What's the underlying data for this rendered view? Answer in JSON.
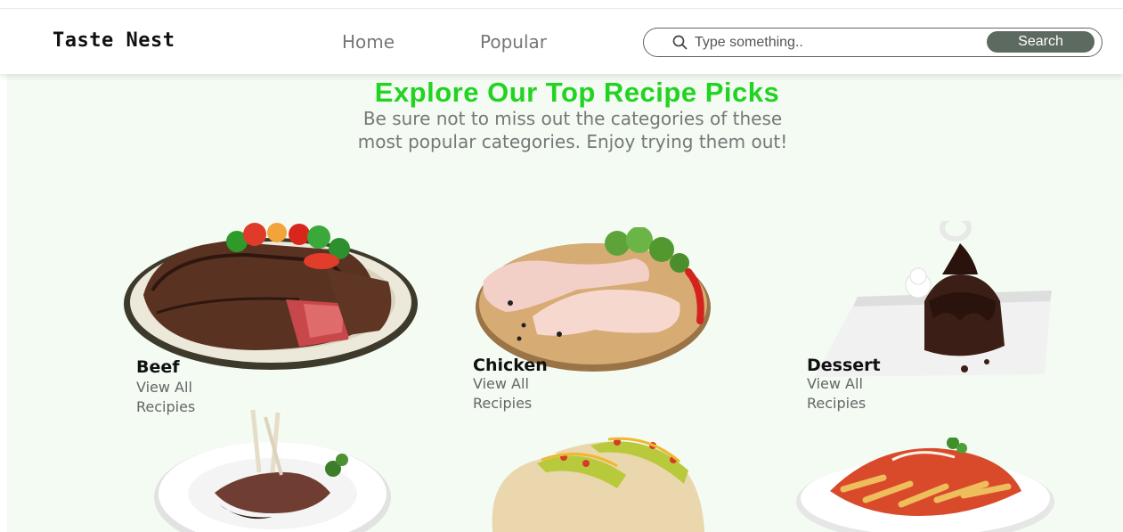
{
  "brand": "Taste Nest",
  "nav": {
    "home": "Home",
    "popular": "Popular"
  },
  "search": {
    "placeholder": "Type something..",
    "button_label": "Search"
  },
  "hero": {
    "title": "Explore Our Top Recipe Picks",
    "subtitle": "Be sure not to miss out the categories of these most popular categories. Enjoy trying them out!"
  },
  "categories": [
    {
      "name": "Beef",
      "link": "View All Recipies",
      "icon": "steak-plate-image"
    },
    {
      "name": "Chicken",
      "link": "View All Recipies",
      "icon": "chicken-board-image"
    },
    {
      "name": "Dessert",
      "link": "View All Recipies",
      "icon": "chocolate-cake-image"
    },
    {
      "name": "",
      "link": "",
      "icon": "lamb-chops-image"
    },
    {
      "name": "",
      "link": "",
      "icon": "tacos-image"
    },
    {
      "name": "",
      "link": "",
      "icon": "pasta-image"
    }
  ],
  "colors": {
    "accent": "#22d322",
    "background": "#f3fbf3",
    "button": "#5d6a60"
  }
}
